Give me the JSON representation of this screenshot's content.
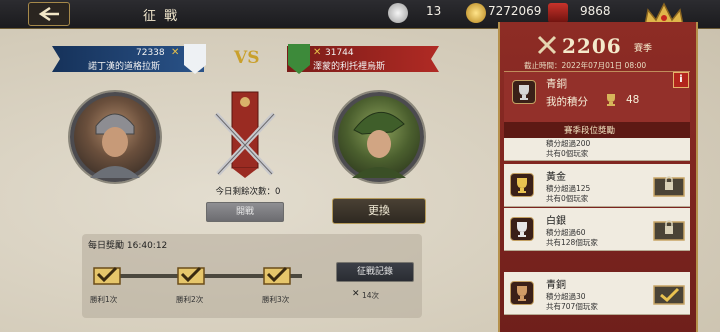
{
  "topbar": {
    "title": "征 戰",
    "silver": "13",
    "gold": "7272069",
    "gems": "9868"
  },
  "match": {
    "vs": "VS",
    "left": {
      "score": "72338",
      "name": "諾丁漢的道格拉斯"
    },
    "right": {
      "score": "31744",
      "name": "澤蒙的利托裡烏斯"
    },
    "remaining": "今日剩餘次數：0",
    "start_button": "開戰",
    "change_button": "更換"
  },
  "daily": {
    "title": "每日獎勵 16:40:12",
    "rewards": [
      {
        "label": "勝利1次"
      },
      {
        "label": "勝利2次"
      },
      {
        "label": "勝利3次"
      }
    ],
    "record_button": "征戰記錄",
    "record_count": "14次"
  },
  "season": {
    "score": "2206",
    "label": "賽季",
    "deadline": "截止時間：2022年07月01日 08:00",
    "current_rank": "青銅",
    "my_points_label": "我的積分",
    "my_points": "48",
    "rewards_header": "賽季段位獎勵",
    "tiers": [
      {
        "name": "",
        "requirement": "積分超過200",
        "players": "共有0個玩家"
      },
      {
        "name": "黃金",
        "requirement": "積分超過125",
        "players": "共有0個玩家"
      },
      {
        "name": "白銀",
        "requirement": "積分超過60",
        "players": "共有128個玩家"
      },
      {
        "name": "青銅",
        "requirement": "積分超過30",
        "players": "共有707個玩家"
      }
    ]
  },
  "colors": {
    "accent_gold": "#c9a02c",
    "left_team": "#2a5389",
    "right_team": "#b02a24",
    "panel": "#8e2c25"
  }
}
